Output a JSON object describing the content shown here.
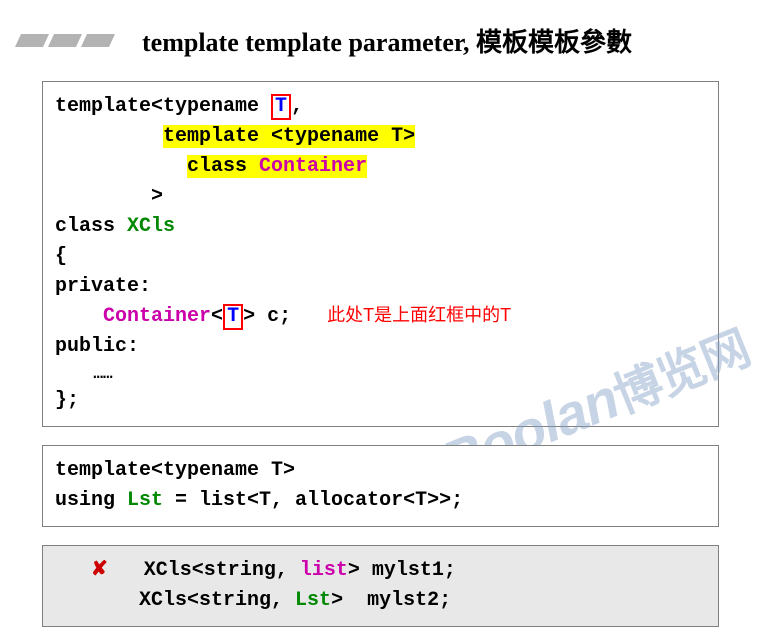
{
  "title": "template template parameter, 模板模板參數",
  "box1": {
    "l1_a": "template<typename ",
    "l1_T": "T",
    "l1_b": ",",
    "l2_a": "         ",
    "l2_hl1": "template <typename T>",
    "l3_a": "           ",
    "l3_hl2a": "class ",
    "l3_hl2b": "Container",
    "l4": "        >",
    "l5a": "class ",
    "l5b": "XCls",
    "l6": "{",
    "l7": "private:",
    "l8a": "    ",
    "l8b": "Container",
    "l8c": "<",
    "l8T": "T",
    "l8d": "> c;",
    "l8ann_sp": "   ",
    "l8ann": "此处T是上面红框中的T",
    "l9": "public:",
    "l10": "    ……",
    "l11": "};"
  },
  "box2": {
    "l1": "template<typename T>",
    "l2a": "using ",
    "l2b": "Lst",
    "l2c": " = list<T, allocator<T>>;"
  },
  "box3": {
    "l1_ind": "   ",
    "l1_x": "✘",
    "l1_sp": "   ",
    "l1a": "XCls<string, ",
    "l1b": "list",
    "l1c": "> mylst1;",
    "l2_ind": "       ",
    "l2a": "XCls<string, ",
    "l2b": "Lst",
    "l2c": ">  mylst2;"
  },
  "watermark": {
    "en": "Boolan",
    "cn": "博览网"
  }
}
